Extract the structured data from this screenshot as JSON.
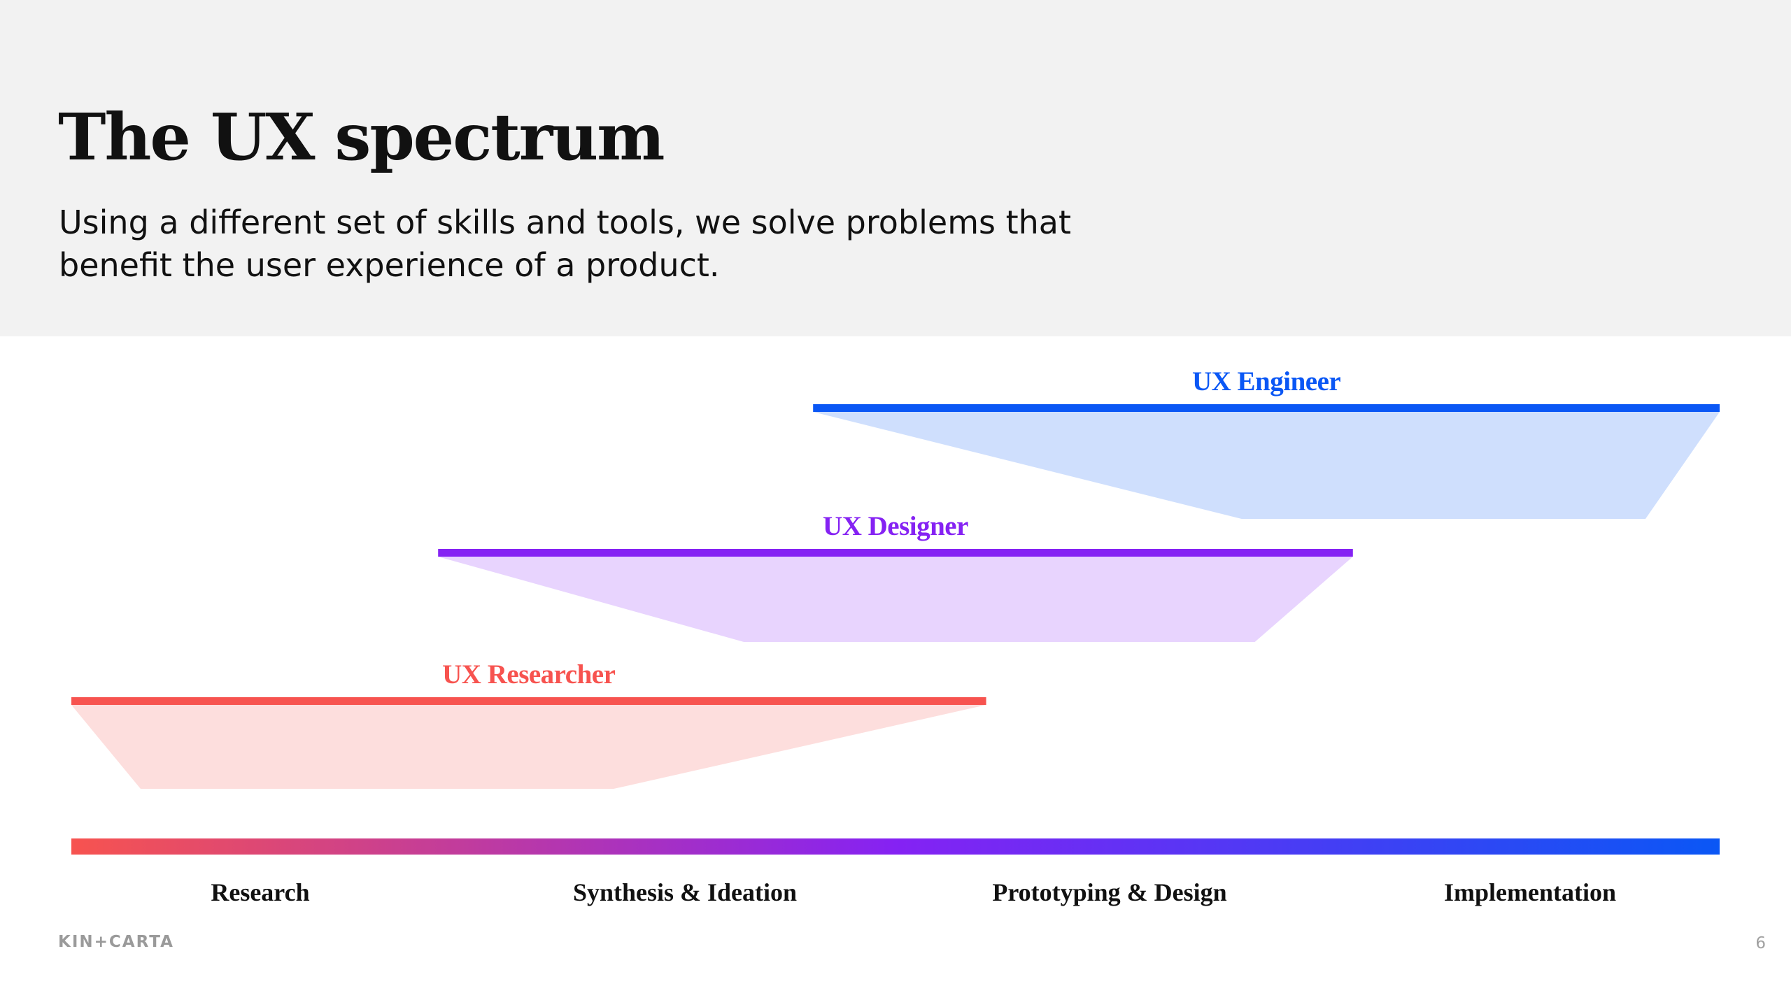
{
  "slide": {
    "title": "The UX spectrum",
    "subtitle": "Using a different set of skills and tools, we solve problems that benefit the user experience of a product.",
    "brand": "KIN+CARTA",
    "page_number": "6"
  },
  "colors": {
    "header_bg": "#f2f2f2",
    "researcher": "#f7534f",
    "researcher_fill": "#fddedd",
    "designer": "#8522f3",
    "designer_fill": "#e8d4fe",
    "engineer": "#0a57f5",
    "engineer_fill": "#cfdffd",
    "gradient_start": "#f7534f",
    "gradient_mid": "#8522f3",
    "gradient_end": "#0a57f5"
  },
  "spectrum": {
    "stages": [
      "Research",
      "Synthesis & Ideation",
      "Prototyping & Design",
      "Implementation"
    ],
    "roles": [
      {
        "key": "engineer",
        "label": "UX Engineer",
        "span_start": 0.45,
        "span_end": 1.0,
        "focus_start": 0.71,
        "focus_end": 0.955
      },
      {
        "key": "designer",
        "label": "UX Designer",
        "span_start": 0.2225,
        "span_end": 0.7775,
        "focus_start": 0.408,
        "focus_end": 0.718
      },
      {
        "key": "researcher",
        "label": "UX Researcher",
        "span_start": 0.0,
        "span_end": 0.555,
        "focus_start": 0.042,
        "focus_end": 0.329
      }
    ]
  }
}
